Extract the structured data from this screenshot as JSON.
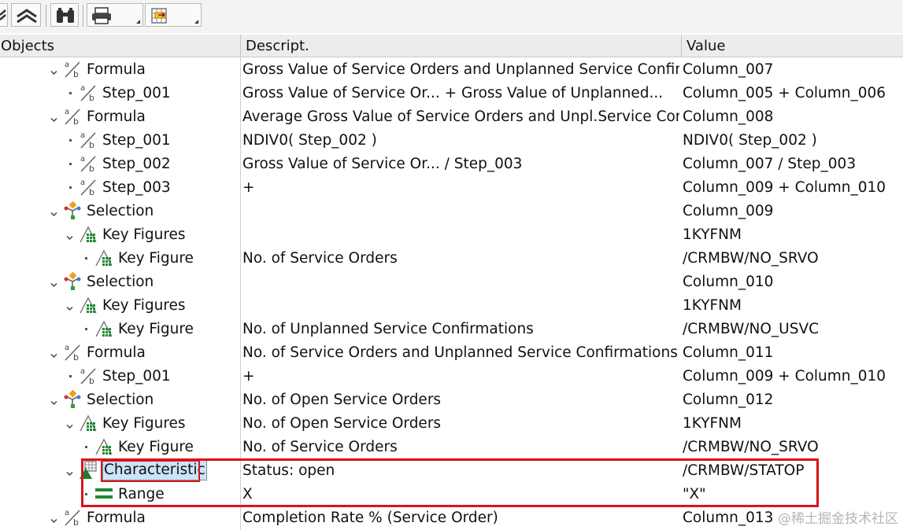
{
  "header": {
    "col_objects": "Objects",
    "col_descript": "Descript.",
    "col_value": "Value"
  },
  "toolbar": {
    "buttons": [
      "collapse-icon",
      "expand-all-icon",
      "find-binoculars-icon",
      "print-icon",
      "export-icon"
    ]
  },
  "rows": [
    {
      "level": 3,
      "expander": "chevron",
      "icon": "formula-icon",
      "label": "Formula",
      "desc": "Gross Value of Service Orders and Unplanned Service Confirm.",
      "value": "Column_007"
    },
    {
      "level": 4,
      "expander": "dot",
      "icon": "formula-icon",
      "label": "Step_001",
      "desc": "Gross Value of Service Or... + Gross Value of Unplanned...",
      "value": "Column_005 + Column_006"
    },
    {
      "level": 3,
      "expander": "chevron",
      "icon": "formula-icon",
      "label": "Formula",
      "desc": "Average Gross Value of Service Orders and Unpl.Service Conf.",
      "value": "Column_008"
    },
    {
      "level": 4,
      "expander": "dot",
      "icon": "formula-icon",
      "label": "Step_001",
      "desc": "NDIV0( Step_002 )",
      "value": "NDIV0( Step_002 )"
    },
    {
      "level": 4,
      "expander": "dot",
      "icon": "formula-icon",
      "label": "Step_002",
      "desc": "Gross Value of Service Or... / Step_003",
      "value": "Column_007 / Step_003"
    },
    {
      "level": 4,
      "expander": "dot",
      "icon": "formula-icon",
      "label": "Step_003",
      "desc": "+",
      "value": "Column_009 + Column_010"
    },
    {
      "level": 3,
      "expander": "chevron",
      "icon": "selection-icon",
      "label": "Selection",
      "desc": "",
      "value": "Column_009"
    },
    {
      "level": 4,
      "expander": "chevron",
      "icon": "key-figures-icon",
      "label": "Key Figures",
      "desc": "",
      "value": "1KYFNM"
    },
    {
      "level": 5,
      "expander": "dot",
      "icon": "key-figures-icon",
      "label": "Key Figure",
      "desc": "No. of Service Orders",
      "value": "/CRMBW/NO_SRVO"
    },
    {
      "level": 3,
      "expander": "chevron",
      "icon": "selection-icon",
      "label": "Selection",
      "desc": "",
      "value": "Column_010"
    },
    {
      "level": 4,
      "expander": "chevron",
      "icon": "key-figures-icon",
      "label": "Key Figures",
      "desc": "",
      "value": "1KYFNM"
    },
    {
      "level": 5,
      "expander": "dot",
      "icon": "key-figures-icon",
      "label": "Key Figure",
      "desc": "No. of Unplanned Service Confirmations",
      "value": "/CRMBW/NO_USVC"
    },
    {
      "level": 3,
      "expander": "chevron",
      "icon": "formula-icon",
      "label": "Formula",
      "desc": "No. of Service Orders and Unplanned Service Confirmations",
      "value": "Column_011"
    },
    {
      "level": 4,
      "expander": "dot",
      "icon": "formula-icon",
      "label": "Step_001",
      "desc": "+",
      "value": "Column_009 + Column_010"
    },
    {
      "level": 3,
      "expander": "chevron",
      "icon": "selection-icon",
      "label": "Selection",
      "desc": "No. of Open Service Orders",
      "value": "Column_012"
    },
    {
      "level": 4,
      "expander": "chevron",
      "icon": "key-figures-icon",
      "label": "Key Figures",
      "desc": "No. of Open Service Orders",
      "value": "1KYFNM"
    },
    {
      "level": 5,
      "expander": "dot",
      "icon": "key-figures-icon",
      "label": "Key Figure",
      "desc": "No. of Service Orders",
      "value": "/CRMBW/NO_SRVO"
    },
    {
      "level": 4,
      "expander": "chevron",
      "icon": "characteristic-icon",
      "label": "Characteristic",
      "desc": "Status: open",
      "value": "/CRMBW/STATOP",
      "selected": true
    },
    {
      "level": 5,
      "expander": "dot",
      "icon": "range-icon",
      "label": "Range",
      "desc": "X",
      "value": "\"X\""
    },
    {
      "level": 3,
      "expander": "chevron",
      "icon": "formula-icon",
      "label": "Formula",
      "desc": "Completion Rate % (Service Order)",
      "value": "Column_013"
    }
  ],
  "watermark": "@稀土掘金技术社区"
}
